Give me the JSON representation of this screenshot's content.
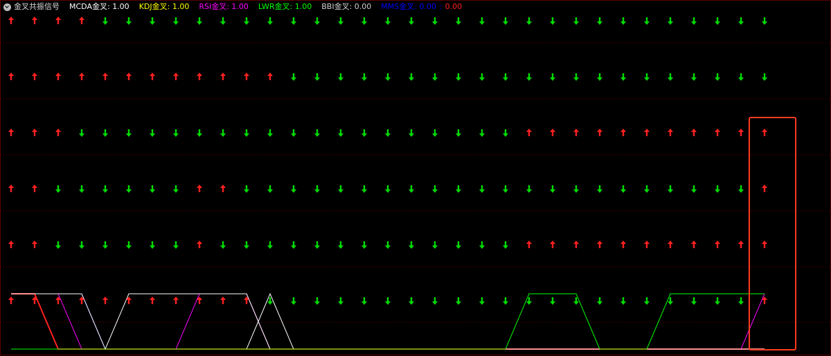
{
  "title": "金叉共振信号",
  "legend": [
    {
      "label": "MCDA金叉",
      "value": "1.00",
      "color": "#ffffff",
      "value_color": "#ffffff"
    },
    {
      "label": "KDJ金叉",
      "value": "1.00",
      "color": "#ffff00",
      "value_color": "#ffff00"
    },
    {
      "label": "RSI金叉",
      "value": "1.00",
      "color": "#ff00ff",
      "value_color": "#ff00ff"
    },
    {
      "label": "LWR金叉",
      "value": "1.00",
      "color": "#00ff00",
      "value_color": "#00ff00"
    },
    {
      "label": "BBI金叉",
      "value": "0.00",
      "color": "#d0d0d0",
      "value_color": "#d0d0d0"
    },
    {
      "label": "MMS金叉",
      "value": "0.00",
      "value2": "0.00",
      "color": "#0000ff",
      "value_color": "#0000ff",
      "value2_color": "#ff2020"
    }
  ],
  "chart_data": {
    "type": "line",
    "x_count": 33,
    "signal_rows": [
      {
        "name": "MCDA金叉",
        "up": [
          1,
          1,
          1,
          1,
          0,
          0,
          0,
          0,
          0,
          0,
          0,
          0,
          0,
          0,
          0,
          0,
          0,
          0,
          0,
          0,
          0,
          0,
          0,
          0,
          0,
          0,
          0,
          0,
          0,
          0,
          0,
          0,
          0
        ]
      },
      {
        "name": "KDJ金叉",
        "up": [
          1,
          1,
          1,
          1,
          1,
          1,
          1,
          1,
          1,
          1,
          1,
          1,
          0,
          0,
          0,
          0,
          0,
          0,
          0,
          0,
          0,
          0,
          0,
          0,
          0,
          0,
          0,
          0,
          0,
          0,
          0,
          0,
          0
        ]
      },
      {
        "name": "RSI金叉",
        "up": [
          1,
          1,
          1,
          0,
          0,
          0,
          0,
          0,
          0,
          0,
          0,
          0,
          0,
          0,
          0,
          0,
          0,
          0,
          0,
          0,
          0,
          0,
          1,
          1,
          1,
          1,
          1,
          1,
          1,
          1,
          1,
          1,
          1
        ]
      },
      {
        "name": "LWR金叉",
        "up": [
          1,
          1,
          0,
          0,
          0,
          0,
          0,
          0,
          1,
          1,
          0,
          0,
          0,
          0,
          0,
          0,
          0,
          0,
          0,
          0,
          0,
          0,
          0,
          0,
          0,
          0,
          0,
          0,
          0,
          0,
          0,
          0,
          1
        ]
      },
      {
        "name": "BBI金叉",
        "up": [
          1,
          1,
          0,
          0,
          0,
          0,
          0,
          0,
          1,
          0,
          0,
          0,
          0,
          0,
          0,
          0,
          0,
          0,
          0,
          0,
          0,
          0,
          1,
          1,
          1,
          1,
          1,
          1,
          1,
          1,
          1,
          1,
          1
        ]
      },
      {
        "name": "MMS金叉",
        "up": [
          1,
          1,
          1,
          1,
          1,
          1,
          1,
          1,
          1,
          1,
          1,
          0,
          0,
          0,
          0,
          0,
          0,
          0,
          0,
          0,
          0,
          0,
          0,
          0,
          0,
          0,
          0,
          0,
          0,
          0,
          0,
          0,
          1
        ]
      }
    ],
    "step_lines": [
      {
        "color": "#ff2020",
        "values": [
          1,
          1,
          0,
          0,
          0,
          0,
          0,
          0,
          0,
          0,
          0,
          0,
          0,
          0,
          0,
          0,
          0,
          0,
          0,
          0,
          0,
          0,
          0,
          0,
          0,
          0,
          0,
          0,
          0,
          0,
          0,
          0,
          0
        ]
      },
      {
        "color": "#0000ff",
        "values": [
          1,
          1,
          1,
          1,
          0,
          0,
          0,
          0,
          0,
          0,
          0,
          0,
          0,
          0,
          0,
          0,
          0,
          0,
          0,
          0,
          0,
          0,
          0,
          0,
          0,
          0,
          0,
          0,
          0,
          0,
          0,
          0,
          0
        ]
      },
      {
        "color": "#ff00ff",
        "values": [
          1,
          1,
          1,
          0,
          0,
          0,
          0,
          0,
          1,
          1,
          1,
          0,
          0,
          0,
          0,
          0,
          0,
          0,
          0,
          0,
          0,
          0,
          0,
          0,
          0,
          0,
          0,
          0,
          0,
          0,
          0,
          0,
          1
        ]
      },
      {
        "color": "#ffffff",
        "values": [
          1,
          1,
          1,
          1,
          0,
          1,
          1,
          1,
          1,
          1,
          1,
          0,
          0,
          0,
          0,
          0,
          0,
          0,
          0,
          0,
          0,
          0,
          0,
          0,
          0,
          0,
          0,
          0,
          0,
          0,
          0,
          0,
          0
        ]
      },
      {
        "color": "#ffffff",
        "values": [
          0,
          0,
          0,
          0,
          0,
          0,
          0,
          0,
          0,
          0,
          0,
          1,
          0,
          0,
          0,
          0,
          0,
          0,
          0,
          0,
          0,
          0,
          0,
          0,
          0,
          0,
          0,
          0,
          0,
          0,
          0,
          0,
          0
        ]
      },
      {
        "color": "#00ff00",
        "values": [
          0,
          0,
          0,
          0,
          0,
          0,
          0,
          0,
          0,
          0,
          0,
          0,
          0,
          0,
          0,
          0,
          0,
          0,
          0,
          0,
          0,
          0,
          1,
          1,
          1,
          0,
          0,
          0,
          1,
          1,
          1,
          1,
          1
        ]
      }
    ],
    "highlight_index": 32,
    "colors": {
      "up": "#ff2020",
      "down": "#00dd00",
      "grid": "#7a0000",
      "highlight": "#ff3b1f"
    }
  }
}
